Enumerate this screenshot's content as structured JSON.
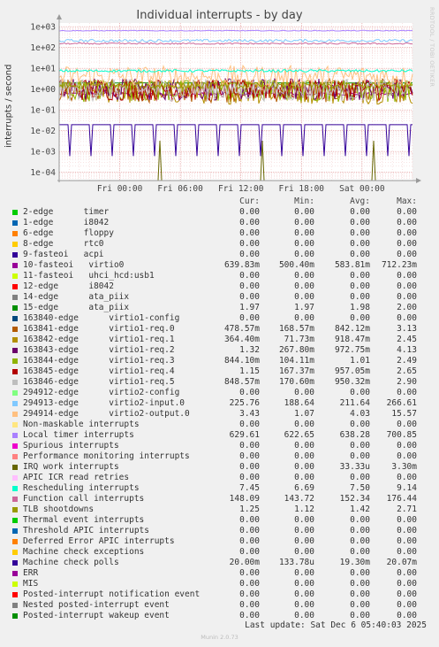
{
  "title": "Individual interrupts - by day",
  "watermark": "RRDTOOL / TOBI OETIKER",
  "footer": {
    "last_update": "Last update: Sat Dec  6 05:40:03 2025",
    "munin": "Munin 2.0.73"
  },
  "chart_data": {
    "type": "line",
    "ylabel": "interrupts / second",
    "yscale": "log",
    "ylim": [
      4e-05,
      1500
    ],
    "yticks": [
      {
        "v": 1000,
        "label": "1e+03"
      },
      {
        "v": 100,
        "label": "1e+02"
      },
      {
        "v": 10,
        "label": "1e+01"
      },
      {
        "v": 1,
        "label": "1e+00"
      },
      {
        "v": 0.1,
        "label": "1e-01"
      },
      {
        "v": 0.01,
        "label": "1e-02"
      },
      {
        "v": 0.001,
        "label": "1e-03"
      },
      {
        "v": 0.0001,
        "label": "1e-04"
      }
    ],
    "xticks": [
      {
        "h": 6,
        "label": "Fri 00:00"
      },
      {
        "h": 12,
        "label": "Fri 06:00"
      },
      {
        "h": 18,
        "label": "Fri 12:00"
      },
      {
        "h": 24,
        "label": "Fri 18:00"
      },
      {
        "h": 30,
        "label": "Sat 00:00"
      }
    ],
    "xrange_hours": [
      0,
      35
    ],
    "grid": true,
    "columns": [
      "Cur:",
      "Min:",
      "Avg:",
      "Max:"
    ],
    "series": [
      {
        "name": "2-edge      timer",
        "color": "#00cc00",
        "cur": "0.00",
        "min": "0.00",
        "avg": "0.00",
        "max": "0.00"
      },
      {
        "name": "1-edge      i8042",
        "color": "#0066b3",
        "cur": "0.00",
        "min": "0.00",
        "avg": "0.00",
        "max": "0.00"
      },
      {
        "name": "6-edge      floppy",
        "color": "#ff8000",
        "cur": "0.00",
        "min": "0.00",
        "avg": "0.00",
        "max": "0.00"
      },
      {
        "name": "8-edge      rtc0",
        "color": "#ffcc00",
        "cur": "0.00",
        "min": "0.00",
        "avg": "0.00",
        "max": "0.00"
      },
      {
        "name": "9-fasteoi   acpi",
        "color": "#330099",
        "cur": "0.00",
        "min": "0.00",
        "avg": "0.00",
        "max": "0.00"
      },
      {
        "name": "10-fasteoi   virtio0",
        "color": "#990099",
        "cur": "639.83m",
        "min": "500.40m",
        "avg": "583.81m",
        "max": "712.23m"
      },
      {
        "name": "11-fasteoi   uhci_hcd:usb1",
        "color": "#ccff00",
        "cur": "0.00",
        "min": "0.00",
        "avg": "0.00",
        "max": "0.00"
      },
      {
        "name": "12-edge      i8042",
        "color": "#ff0000",
        "cur": "0.00",
        "min": "0.00",
        "avg": "0.00",
        "max": "0.00"
      },
      {
        "name": "14-edge      ata_piix",
        "color": "#808080",
        "cur": "0.00",
        "min": "0.00",
        "avg": "0.00",
        "max": "0.00"
      },
      {
        "name": "15-edge      ata_piix",
        "color": "#008f00",
        "cur": "1.97",
        "min": "1.97",
        "avg": "1.98",
        "max": "2.00"
      },
      {
        "name": "163840-edge      virtio1-config",
        "color": "#00487d",
        "cur": "0.00",
        "min": "0.00",
        "avg": "0.00",
        "max": "0.00"
      },
      {
        "name": "163841-edge      virtio1-req.0",
        "color": "#b35a00",
        "cur": "478.57m",
        "min": "168.57m",
        "avg": "842.12m",
        "max": "3.13"
      },
      {
        "name": "163842-edge      virtio1-req.1",
        "color": "#b38f00",
        "cur": "364.40m",
        "min": "71.73m",
        "avg": "918.47m",
        "max": "2.45"
      },
      {
        "name": "163843-edge      virtio1-req.2",
        "color": "#6b006b",
        "cur": "1.32",
        "min": "267.80m",
        "avg": "972.75m",
        "max": "4.13"
      },
      {
        "name": "163844-edge      virtio1-req.3",
        "color": "#8fb300",
        "cur": "844.10m",
        "min": "104.11m",
        "avg": "1.01",
        "max": "2.49"
      },
      {
        "name": "163845-edge      virtio1-req.4",
        "color": "#b30000",
        "cur": "1.15",
        "min": "167.37m",
        "avg": "957.05m",
        "max": "2.65"
      },
      {
        "name": "163846-edge      virtio1-req.5",
        "color": "#bebebe",
        "cur": "848.57m",
        "min": "170.60m",
        "avg": "950.32m",
        "max": "2.90"
      },
      {
        "name": "294912-edge      virtio2-config",
        "color": "#80ff80",
        "cur": "0.00",
        "min": "0.00",
        "avg": "0.00",
        "max": "0.00"
      },
      {
        "name": "294913-edge      virtio2-input.0",
        "color": "#80c9ff",
        "cur": "225.76",
        "min": "188.64",
        "avg": "211.64",
        "max": "266.61"
      },
      {
        "name": "294914-edge      virtio2-output.0",
        "color": "#ffc080",
        "cur": "3.43",
        "min": "1.07",
        "avg": "4.03",
        "max": "15.57"
      },
      {
        "name": "Non-maskable interrupts",
        "color": "#ffe680",
        "cur": "0.00",
        "min": "0.00",
        "avg": "0.00",
        "max": "0.00"
      },
      {
        "name": "Local timer interrupts",
        "color": "#aa80ff",
        "cur": "629.61",
        "min": "622.65",
        "avg": "638.28",
        "max": "700.85"
      },
      {
        "name": "Spurious interrupts",
        "color": "#ee00cc",
        "cur": "0.00",
        "min": "0.00",
        "avg": "0.00",
        "max": "0.00"
      },
      {
        "name": "Performance monitoring interrupts",
        "color": "#ff8080",
        "cur": "0.00",
        "min": "0.00",
        "avg": "0.00",
        "max": "0.00"
      },
      {
        "name": "IRQ work interrupts",
        "color": "#666600",
        "cur": "0.00",
        "min": "0.00",
        "avg": "33.33u",
        "max": "3.30m"
      },
      {
        "name": "APIC ICR read retries",
        "color": "#ffbfff",
        "cur": "0.00",
        "min": "0.00",
        "avg": "0.00",
        "max": "0.00"
      },
      {
        "name": "Rescheduling interrupts",
        "color": "#00ffcc",
        "cur": "7.45",
        "min": "6.69",
        "avg": "7.50",
        "max": "9.14"
      },
      {
        "name": "Function call interrupts",
        "color": "#cc6699",
        "cur": "148.09",
        "min": "143.72",
        "avg": "152.34",
        "max": "176.44"
      },
      {
        "name": "TLB shootdowns",
        "color": "#999900",
        "cur": "1.25",
        "min": "1.12",
        "avg": "1.42",
        "max": "2.71"
      },
      {
        "name": "Thermal event interrupts",
        "color": "#00cc00",
        "cur": "0.00",
        "min": "0.00",
        "avg": "0.00",
        "max": "0.00"
      },
      {
        "name": "Threshold APIC interrupts",
        "color": "#0066b3",
        "cur": "0.00",
        "min": "0.00",
        "avg": "0.00",
        "max": "0.00"
      },
      {
        "name": "Deferred Error APIC interrupts",
        "color": "#ff8000",
        "cur": "0.00",
        "min": "0.00",
        "avg": "0.00",
        "max": "0.00"
      },
      {
        "name": "Machine check exceptions",
        "color": "#ffcc00",
        "cur": "0.00",
        "min": "0.00",
        "avg": "0.00",
        "max": "0.00"
      },
      {
        "name": "Machine check polls",
        "color": "#330099",
        "cur": "20.00m",
        "min": "133.78u",
        "avg": "19.30m",
        "max": "20.07m"
      },
      {
        "name": "ERR",
        "color": "#990099",
        "cur": "0.00",
        "min": "0.00",
        "avg": "0.00",
        "max": "0.00"
      },
      {
        "name": "MIS",
        "color": "#ccff00",
        "cur": "0.00",
        "min": "0.00",
        "avg": "0.00",
        "max": "0.00"
      },
      {
        "name": "Posted-interrupt notification event",
        "color": "#ff0000",
        "cur": "0.00",
        "min": "0.00",
        "avg": "0.00",
        "max": "0.00"
      },
      {
        "name": "Nested posted-interrupt event",
        "color": "#808080",
        "cur": "0.00",
        "min": "0.00",
        "avg": "0.00",
        "max": "0.00"
      },
      {
        "name": "Posted-interrupt wakeup event",
        "color": "#008f00",
        "cur": "0.00",
        "min": "0.00",
        "avg": "0.00",
        "max": "0.00"
      }
    ]
  }
}
